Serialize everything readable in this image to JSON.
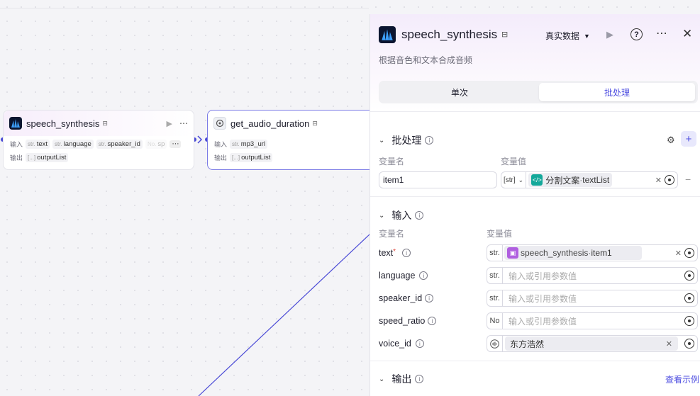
{
  "canvas": {
    "node1": {
      "title": "speech_synthesis",
      "in_label": "输入",
      "out_label": "输出",
      "inputs": [
        {
          "type": "str.",
          "name": "text"
        },
        {
          "type": "str.",
          "name": "language"
        },
        {
          "type": "str.",
          "name": "speaker_id"
        },
        {
          "type": "No.",
          "name": "sp"
        }
      ],
      "outputs": [
        {
          "type": "[...]",
          "name": "outputList"
        }
      ]
    },
    "node2": {
      "title": "get_audio_duration",
      "in_label": "输入",
      "out_label": "输出",
      "inputs": [
        {
          "type": "str.",
          "name": "mp3_url"
        }
      ],
      "outputs": [
        {
          "type": "[...]",
          "name": "outputList"
        }
      ]
    }
  },
  "panel": {
    "title": "speech_synthesis",
    "data_mode": "真实数据",
    "description": "根据音色和文本合成音频",
    "tabs": [
      "单次",
      "批处理"
    ],
    "active_tab": "批处理",
    "batch": {
      "section_title": "批处理",
      "col_name": "变量名",
      "col_value": "变量值",
      "var_name": "item1",
      "var_type": "[str]",
      "ref_node": "分割文案",
      "ref_sep": " · ",
      "ref_field": "textList",
      "remove": "−"
    },
    "input": {
      "section_title": "输入",
      "col_name": "变量名",
      "col_value": "变量值",
      "rows": [
        {
          "name": "text",
          "required": "*",
          "type": "str.",
          "ref_node": "speech_synthesis",
          "ref_sep": " · ",
          "ref_field": "item1"
        },
        {
          "name": "language",
          "type": "str.",
          "placeholder": "输入或引用参数值"
        },
        {
          "name": "speaker_id",
          "type": "str.",
          "placeholder": "输入或引用参数值"
        },
        {
          "name": "speed_ratio",
          "type": "No",
          "placeholder": "输入或引用参数值"
        },
        {
          "name": "voice_id",
          "value": "东方浩然"
        }
      ]
    },
    "output": {
      "section_title": "输出",
      "example_link": "查看示例"
    }
  }
}
